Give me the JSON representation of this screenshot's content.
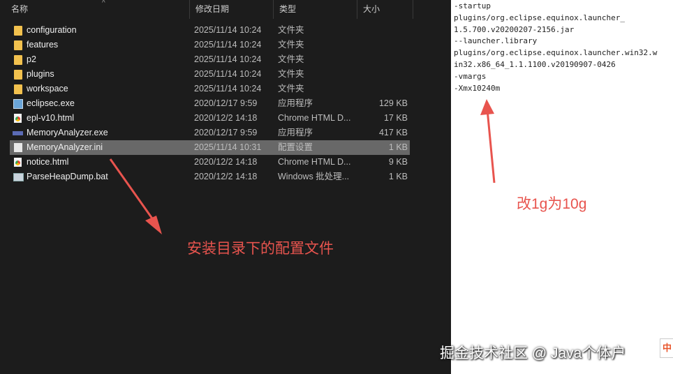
{
  "explorer": {
    "columns": [
      "名称",
      "修改日期",
      "类型",
      "大小"
    ],
    "files": [
      {
        "icon": "folder-icon",
        "name": "configuration",
        "date": "2025/11/14 10:24",
        "type": "文件夹",
        "size": ""
      },
      {
        "icon": "folder-icon",
        "name": "features",
        "date": "2025/11/14 10:24",
        "type": "文件夹",
        "size": ""
      },
      {
        "icon": "folder-icon",
        "name": "p2",
        "date": "2025/11/14 10:24",
        "type": "文件夹",
        "size": ""
      },
      {
        "icon": "folder-icon",
        "name": "plugins",
        "date": "2025/11/14 10:24",
        "type": "文件夹",
        "size": ""
      },
      {
        "icon": "folder-icon",
        "name": "workspace",
        "date": "2025/11/14 10:24",
        "type": "文件夹",
        "size": ""
      },
      {
        "icon": "exe-icon",
        "name": "eclipsec.exe",
        "date": "2020/12/17 9:59",
        "type": "应用程序",
        "size": "129 KB"
      },
      {
        "icon": "html-icon",
        "name": "epl-v10.html",
        "date": "2020/12/2 14:18",
        "type": "Chrome HTML D...",
        "size": "17 KB"
      },
      {
        "icon": "mat-icon",
        "name": "MemoryAnalyzer.exe",
        "date": "2020/12/17 9:59",
        "type": "应用程序",
        "size": "417 KB"
      },
      {
        "icon": "ini-icon",
        "name": "MemoryAnalyzer.ini",
        "date": "2025/11/14 10:31",
        "type": "配置设置",
        "size": "1 KB"
      },
      {
        "icon": "html-icon",
        "name": "notice.html",
        "date": "2020/12/2 14:18",
        "type": "Chrome HTML D...",
        "size": "9 KB"
      },
      {
        "icon": "bat-icon",
        "name": "ParseHeapDump.bat",
        "date": "2020/12/2 14:18",
        "type": "Windows 批处理...",
        "size": "1 KB"
      }
    ]
  },
  "editor": {
    "lines": [
      "-startup",
      "plugins/org.eclipse.equinox.launcher_",
      "1.5.700.v20200207-2156.jar",
      "--launcher.library",
      "plugins/org.eclipse.equinox.launcher.win32.w",
      "in32.x86_64_1.1.1100.v20190907-0426",
      "-vmargs",
      "-Xmx10240m"
    ]
  },
  "annotations": {
    "left": "安装目录下的配置文件",
    "right": "改1g为10g",
    "color": "#e8544e"
  },
  "watermark": "掘金技术社区 @ Java个体户",
  "tray_glyph": "中"
}
